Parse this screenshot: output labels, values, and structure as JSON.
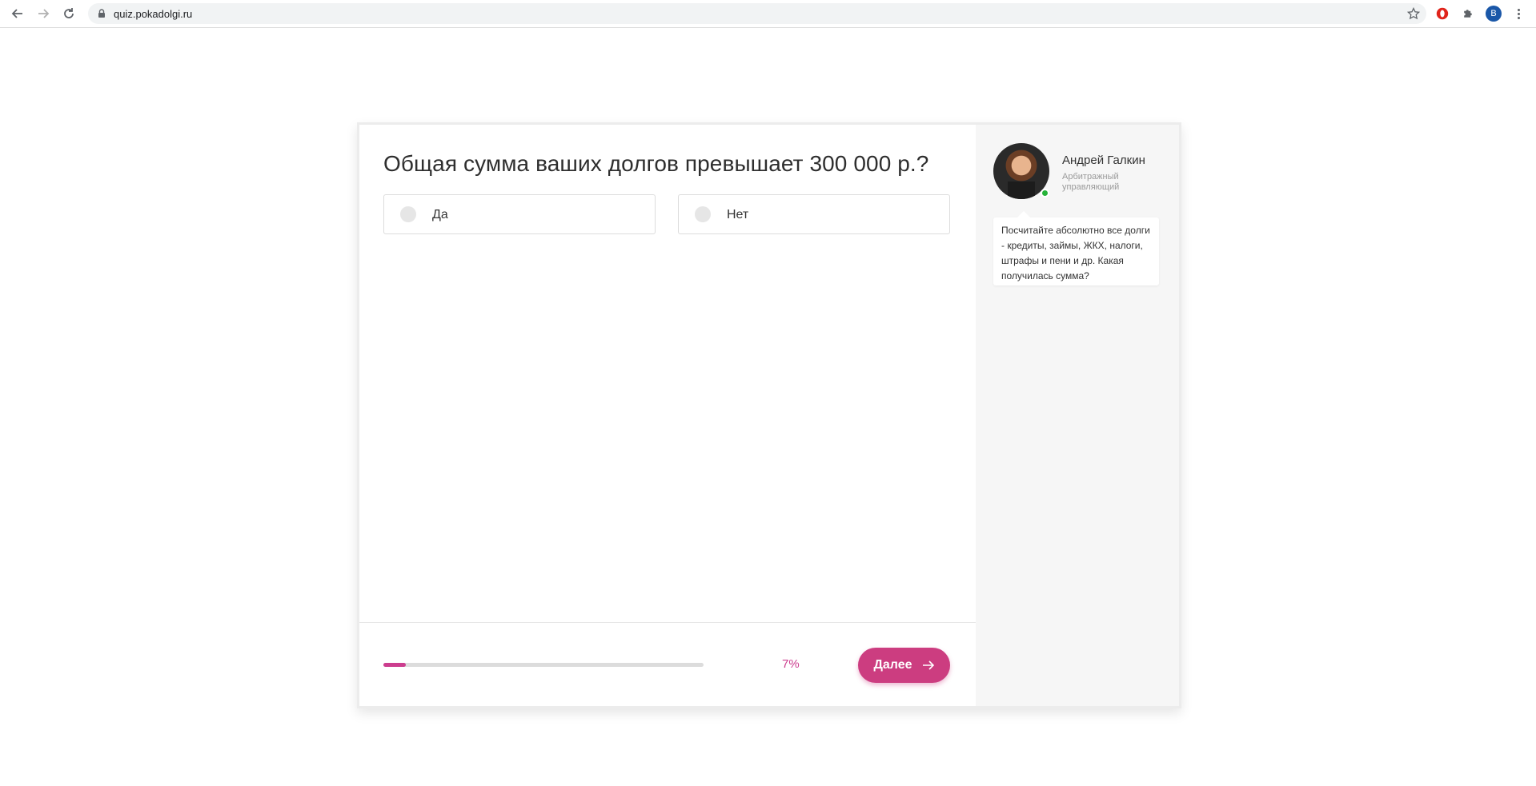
{
  "browser": {
    "url": "quiz.pokadolgi.ru",
    "profile_initial": "B"
  },
  "quiz": {
    "question": "Общая сумма ваших долгов превышает 300 000 р.?",
    "options": [
      {
        "label": "Да"
      },
      {
        "label": "Нет"
      }
    ],
    "progress_percent": 7,
    "progress_label": "7%",
    "next_label": "Далее"
  },
  "consultant": {
    "name": "Андрей Галкин",
    "role": "Арбитражный управляющий",
    "status": "online",
    "message": "Посчитайте абсолютно все долги - кредиты, займы, ЖКХ, налоги, штрафы и пени и др. Какая получилась сумма?"
  },
  "colors": {
    "accent": "#cc3d80",
    "online": "#27b33a",
    "sidebar_bg": "#f6f6f6"
  }
}
